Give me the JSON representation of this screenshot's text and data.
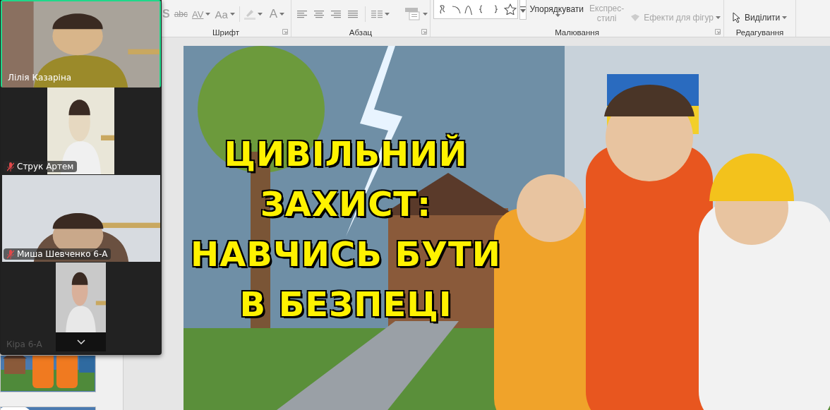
{
  "ribbon": {
    "groups": [
      {
        "kind": "font",
        "label": "Шрифт",
        "tools": [
          {
            "label": "S",
            "kind": "shadow",
            "dropdown": false
          },
          {
            "label": "abc",
            "kind": "strike",
            "dropdown": false
          },
          {
            "label": "AV",
            "kind": "spacing",
            "dropdown": true
          },
          {
            "label": "Aa",
            "kind": "case",
            "dropdown": true
          },
          {
            "kind": "highlight",
            "dropdown": true
          },
          {
            "label": "A",
            "kind": "color",
            "dropdown": true
          }
        ]
      },
      {
        "kind": "paragraph",
        "label": "Абзац"
      },
      {
        "kind": "drawing",
        "label": "Малювання",
        "buttons": [
          {
            "kind": "arrange",
            "lines": [
              "Упорядкувати"
            ],
            "disabled": false
          },
          {
            "kind": "styles",
            "lines": [
              "Експрес-",
              "стилі"
            ],
            "disabled": true
          },
          {
            "kind": "effects",
            "lines": [
              "Ефекти для фігур"
            ],
            "disabled": true
          }
        ]
      },
      {
        "kind": "editing",
        "label": "Редагування",
        "buttons": [
          {
            "kind": "select",
            "lines": [
              "Виділити"
            ],
            "disabled": false
          }
        ]
      }
    ]
  },
  "slide": {
    "title_lines": [
      "ЦИВІЛЬНИЙ",
      "ЗАХИСТ:",
      "НАВЧИСЬ БУТИ",
      "В БЕЗПЕЦІ"
    ]
  },
  "meeting": {
    "participants": [
      {
        "name": "Лілія Казаріна",
        "kind": "wide",
        "muted": false,
        "speaking": true
      },
      {
        "name": "Струк Артем",
        "kind": "narrow",
        "muted": true,
        "speaking": false
      },
      {
        "name": "Миша Шевченко 6-А",
        "kind": "wide",
        "muted": true,
        "speaking": false
      },
      {
        "name": "Кіра 6-А",
        "kind": "narrow-dim",
        "muted": false,
        "speaking": false
      }
    ]
  }
}
